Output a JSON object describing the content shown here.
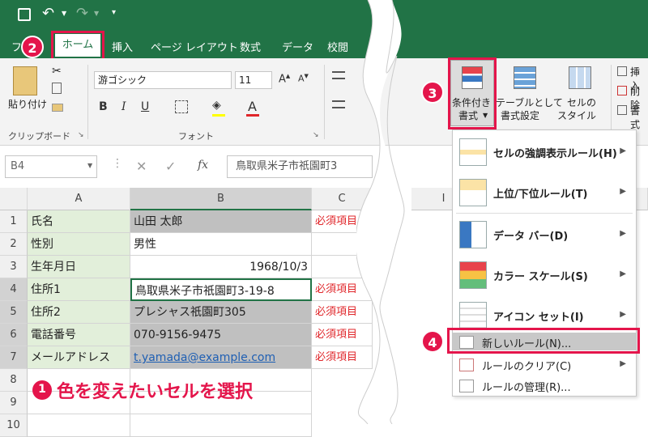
{
  "tabs": {
    "home": "ホーム",
    "insert": "挿入",
    "page_layout": "ページ レイアウト",
    "formulas": "数式",
    "data": "データ",
    "review": "校閲"
  },
  "ribbon": {
    "paste_label": "貼り付け",
    "clipboard_group": "クリップボード",
    "font_group": "フォント",
    "font_name": "游ゴシック",
    "font_size": "11",
    "bold": "B",
    "italic": "I",
    "underline": "U",
    "font_color_letter": "A",
    "cond_format_line1": "条件付き",
    "cond_format_line2": "書式",
    "table_format_line1": "テーブルとして",
    "table_format_line2": "書式設定",
    "cell_style_line1": "セルの",
    "cell_style_line2": "スタイル",
    "insert_label": "挿入",
    "delete_label": "削除",
    "format_label": "書式"
  },
  "formula_bar": {
    "name_box": "B4",
    "fx": "fx",
    "content": "鳥取県米子市祇園町3"
  },
  "columns": [
    "A",
    "B",
    "C",
    "I"
  ],
  "rows": [
    {
      "num": "1",
      "a": "氏名",
      "b": "山田 太郎",
      "c": "必須項目"
    },
    {
      "num": "2",
      "a": "性別",
      "b": "男性",
      "c": ""
    },
    {
      "num": "3",
      "a": "生年月日",
      "b": "1968/10/3",
      "c": ""
    },
    {
      "num": "4",
      "a": "住所1",
      "b": "鳥取県米子市祇園町3-19-8",
      "c": "必須項目"
    },
    {
      "num": "5",
      "a": "住所2",
      "b": "プレシャス祇園町305",
      "c": "必須項目"
    },
    {
      "num": "6",
      "a": "電話番号",
      "b": "070-9156-9475",
      "c": "必須項目"
    },
    {
      "num": "7",
      "a": "メールアドレス",
      "b": "t.yamada@example.com",
      "c": "必須項目"
    },
    {
      "num": "8",
      "a": "",
      "b": "",
      "c": ""
    },
    {
      "num": "9",
      "a": "",
      "b": "",
      "c": ""
    },
    {
      "num": "10",
      "a": "",
      "b": "",
      "c": ""
    }
  ],
  "annotation_text": "色を変えたいセルを選択",
  "badges": [
    "2",
    "3",
    "4",
    "1"
  ],
  "menu": {
    "items": [
      {
        "label": "セルの強調表示ルール(H)",
        "icon": "highlight-rules-icon"
      },
      {
        "label": "上位/下位ルール(T)",
        "icon": "top-bottom-rules-icon"
      },
      {
        "label": "データ バー(D)",
        "icon": "data-bars-icon"
      },
      {
        "label": "カラー スケール(S)",
        "icon": "color-scales-icon"
      },
      {
        "label": "アイコン セット(I)",
        "icon": "icon-sets-icon"
      }
    ],
    "new_rule": "新しいルール(N)...",
    "clear_rules": "ルールのクリア(C)",
    "manage_rules": "ルールの管理(R)..."
  },
  "colors": {
    "excel_green": "#217346",
    "highlight_red": "#e4154b",
    "column_a_fill": "#e2efda",
    "selected_gray": "#c0c0c0",
    "required_red": "#e0262a"
  }
}
